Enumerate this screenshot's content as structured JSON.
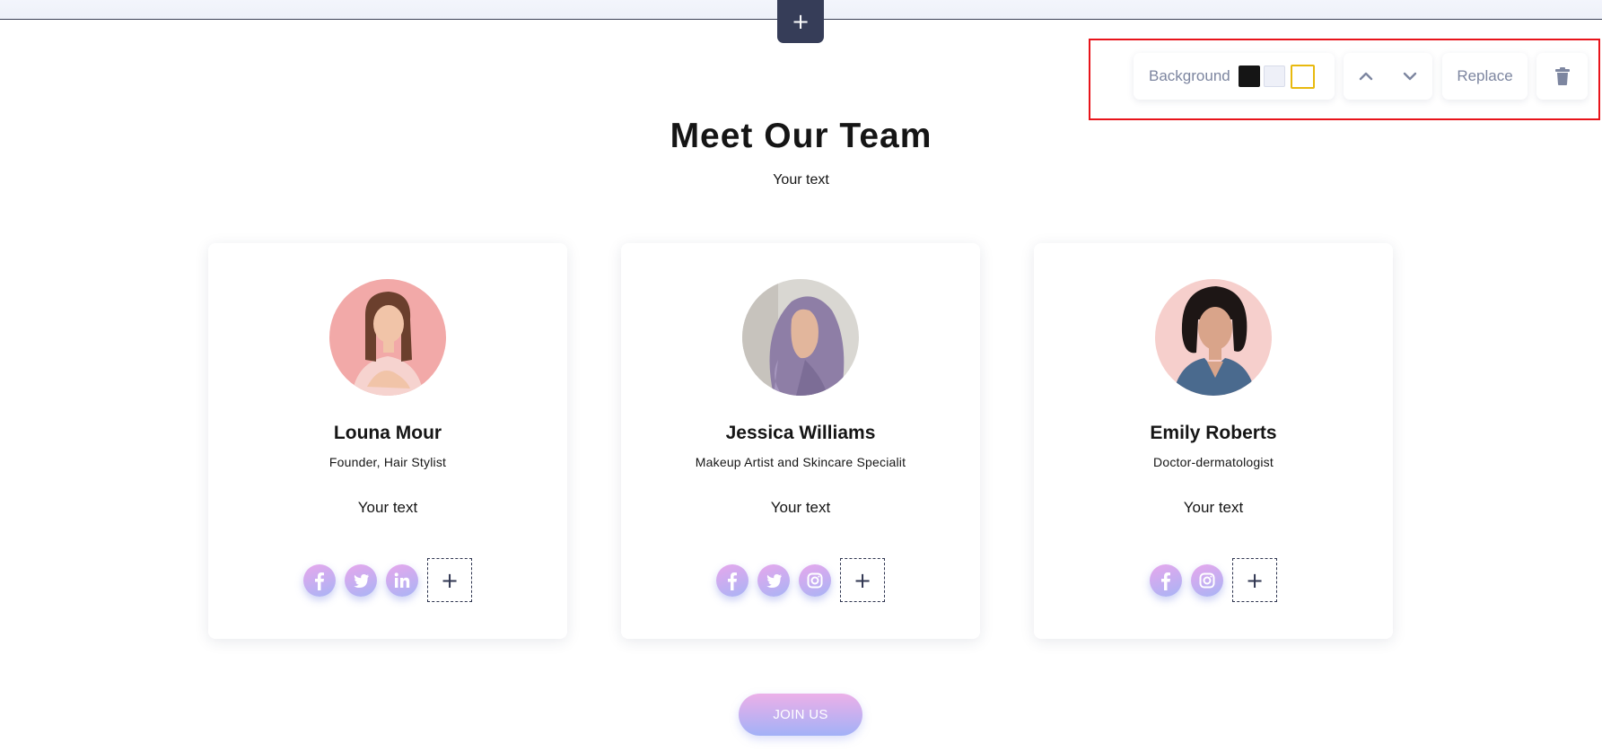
{
  "editor": {
    "add_section_label": "+",
    "toolbar": {
      "background_label": "Background",
      "swatches": [
        {
          "name": "black",
          "color": "#151515"
        },
        {
          "name": "light-gray",
          "color": "#eef0f8"
        },
        {
          "name": "white",
          "color": "#ffffff",
          "selected": true
        }
      ],
      "move_up_icon": "chevron-up-icon",
      "move_down_icon": "chevron-down-icon",
      "replace_label": "Replace",
      "delete_icon": "trash-icon"
    }
  },
  "section": {
    "title": "Meet Our Team",
    "subtitle": "Your text"
  },
  "members": [
    {
      "name": "Louna Mour",
      "role": "Founder, Hair Stylist",
      "text": "Your text",
      "socials": [
        "facebook-icon",
        "twitter-icon",
        "linkedin-icon"
      ]
    },
    {
      "name": "Jessica Williams",
      "role": "Makeup Artist and Skincare Specialit",
      "text": "Your text",
      "socials": [
        "facebook-icon",
        "twitter-icon",
        "instagram-icon"
      ]
    },
    {
      "name": "Emily Roberts",
      "role": "Doctor-dermatologist",
      "text": "Your text",
      "socials": [
        "facebook-icon",
        "instagram-icon"
      ]
    }
  ],
  "add_social_label": "+",
  "join_button": "JOIN US",
  "colors": {
    "accent_dark": "#363d58",
    "selection_frame": "#e8141b",
    "gradient_pink": "#e7a7ec",
    "gradient_blue": "#a8b4f5"
  }
}
